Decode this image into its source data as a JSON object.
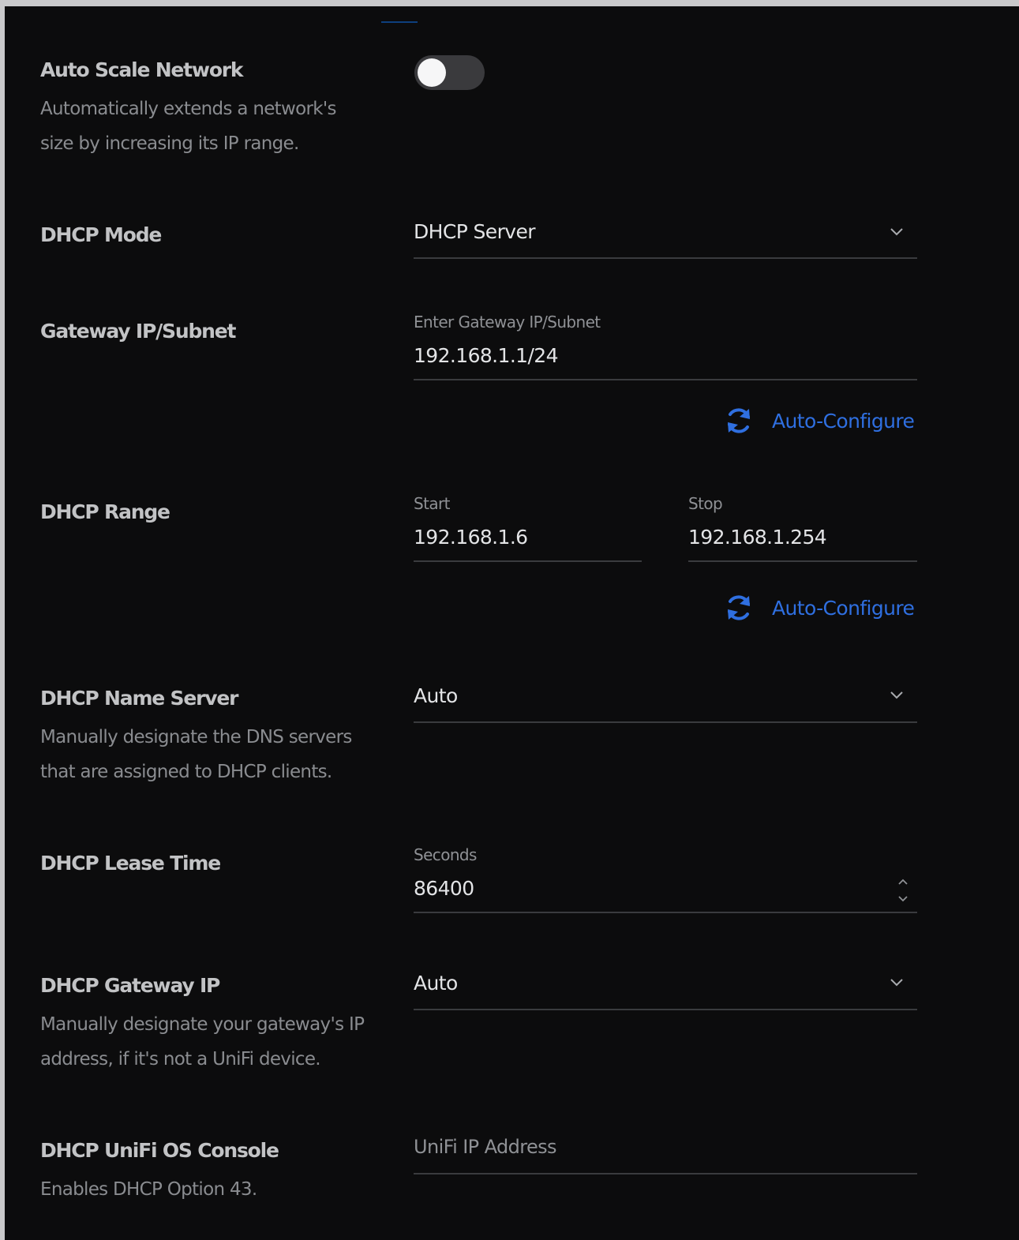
{
  "auto_scale": {
    "label": "Auto Scale Network",
    "description": "Automatically extends a network's size by increasing its IP range.",
    "enabled": false
  },
  "dhcp_mode": {
    "label": "DHCP Mode",
    "value": "DHCP Server"
  },
  "gateway": {
    "label": "Gateway IP/Subnet",
    "hint": "Enter Gateway IP/Subnet",
    "value": "192.168.1.1/24",
    "auto_configure": "Auto-Configure"
  },
  "dhcp_range": {
    "label": "DHCP Range",
    "start_hint": "Start",
    "start_value": "192.168.1.6",
    "stop_hint": "Stop",
    "stop_value": "192.168.1.254",
    "auto_configure": "Auto-Configure"
  },
  "name_server": {
    "label": "DHCP Name Server",
    "description": "Manually designate the DNS servers that are assigned to DHCP clients.",
    "value": "Auto"
  },
  "lease_time": {
    "label": "DHCP Lease Time",
    "hint": "Seconds",
    "value": "86400"
  },
  "gateway_ip": {
    "label": "DHCP Gateway IP",
    "description": "Manually designate your gateway's IP address, if it's not a UniFi device.",
    "value": "Auto"
  },
  "unifi_console": {
    "label": "DHCP UniFi OS Console",
    "description": "Enables DHCP Option 43.",
    "placeholder": "UniFi IP Address"
  },
  "colors": {
    "background": "#0c0c0d",
    "accent": "#2f6fe0",
    "label": "#c2c3c5",
    "muted": "#8a8c90"
  },
  "icons": {
    "dropdown": "chevron-down-icon",
    "refresh": "refresh-icon",
    "stepper": "stepper-icon"
  }
}
